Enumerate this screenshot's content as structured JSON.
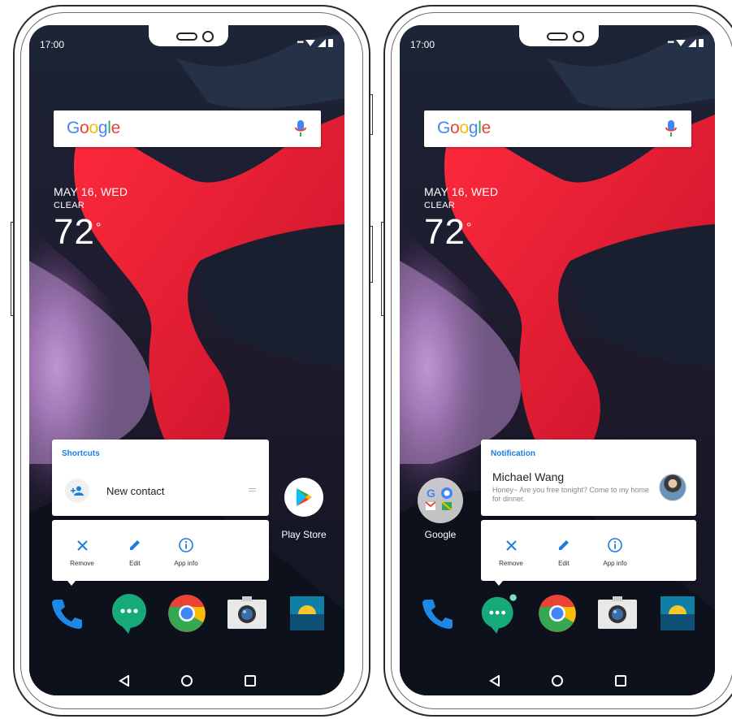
{
  "status_bar": {
    "time": "17:00"
  },
  "search": {
    "logo": [
      "G",
      "o",
      "o",
      "g",
      "l",
      "e"
    ],
    "logo_colors": [
      "#4285F4",
      "#EA4335",
      "#FBBC05",
      "#4285F4",
      "#34A853",
      "#EA4335"
    ]
  },
  "weather": {
    "date": "MAY 16, WED",
    "condition": "CLEAR",
    "temperature": "72",
    "degree_symbol": "°"
  },
  "left_screen": {
    "card_title": "Shortcuts",
    "shortcut_label": "New contact",
    "actions": [
      {
        "label": "Remove",
        "icon": "close-icon"
      },
      {
        "label": "Edit",
        "icon": "pencil-icon"
      },
      {
        "label": "App info",
        "icon": "info-icon"
      }
    ],
    "side_app": {
      "label": "Play Store",
      "icon": "play-store-icon"
    }
  },
  "right_screen": {
    "card_title": "Notification",
    "sender": "Michael Wang",
    "message": "Honey~ Are you free tonight? Come to my home for dinner.",
    "actions": [
      {
        "label": "Remove",
        "icon": "close-icon"
      },
      {
        "label": "Edit",
        "icon": "pencil-icon"
      },
      {
        "label": "App info",
        "icon": "info-icon"
      }
    ],
    "side_app": {
      "label": "Google",
      "icon": "google-folder-icon"
    }
  },
  "dock": [
    "phone-icon",
    "messages-icon",
    "chrome-icon",
    "camera-icon",
    "gallery-icon"
  ],
  "colors": {
    "accent": "#1a7ee0",
    "phone_blue": "#1e88e5",
    "messages_green": "#16a97a"
  }
}
